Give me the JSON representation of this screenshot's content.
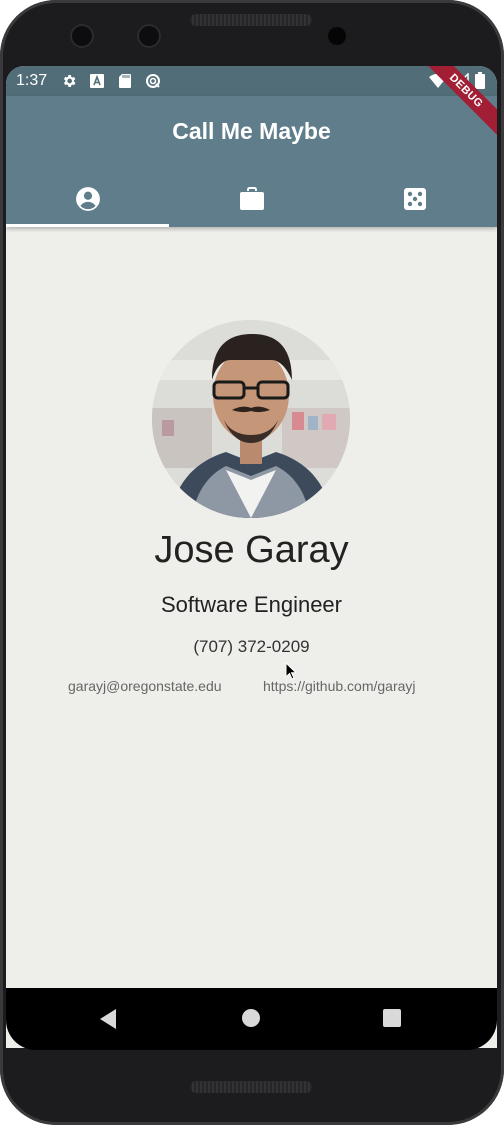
{
  "status_bar": {
    "time": "1:37",
    "icons_left": [
      "gear-icon",
      "text-a-icon",
      "sd-card-icon",
      "sync-icon"
    ],
    "icons_right": [
      "wifi-icon",
      "signal-icon",
      "battery-icon"
    ]
  },
  "debug_banner": "DEBUG",
  "app_bar": {
    "title": "Call Me Maybe",
    "tabs": [
      {
        "icon": "account-circle-icon",
        "selected": true
      },
      {
        "icon": "briefcase-icon",
        "selected": false
      },
      {
        "icon": "dice-icon",
        "selected": false
      }
    ]
  },
  "profile": {
    "name": "Jose Garay",
    "title": "Software Engineer",
    "phone": "(707) 372-0209",
    "email": "garayj@oregonstate.edu",
    "github": "https://github.com/garayj"
  },
  "colors": {
    "app_bar": "#607d8b",
    "status_bar": "#516d77",
    "background": "#eeeeea",
    "debug_banner": "#a11e35"
  }
}
